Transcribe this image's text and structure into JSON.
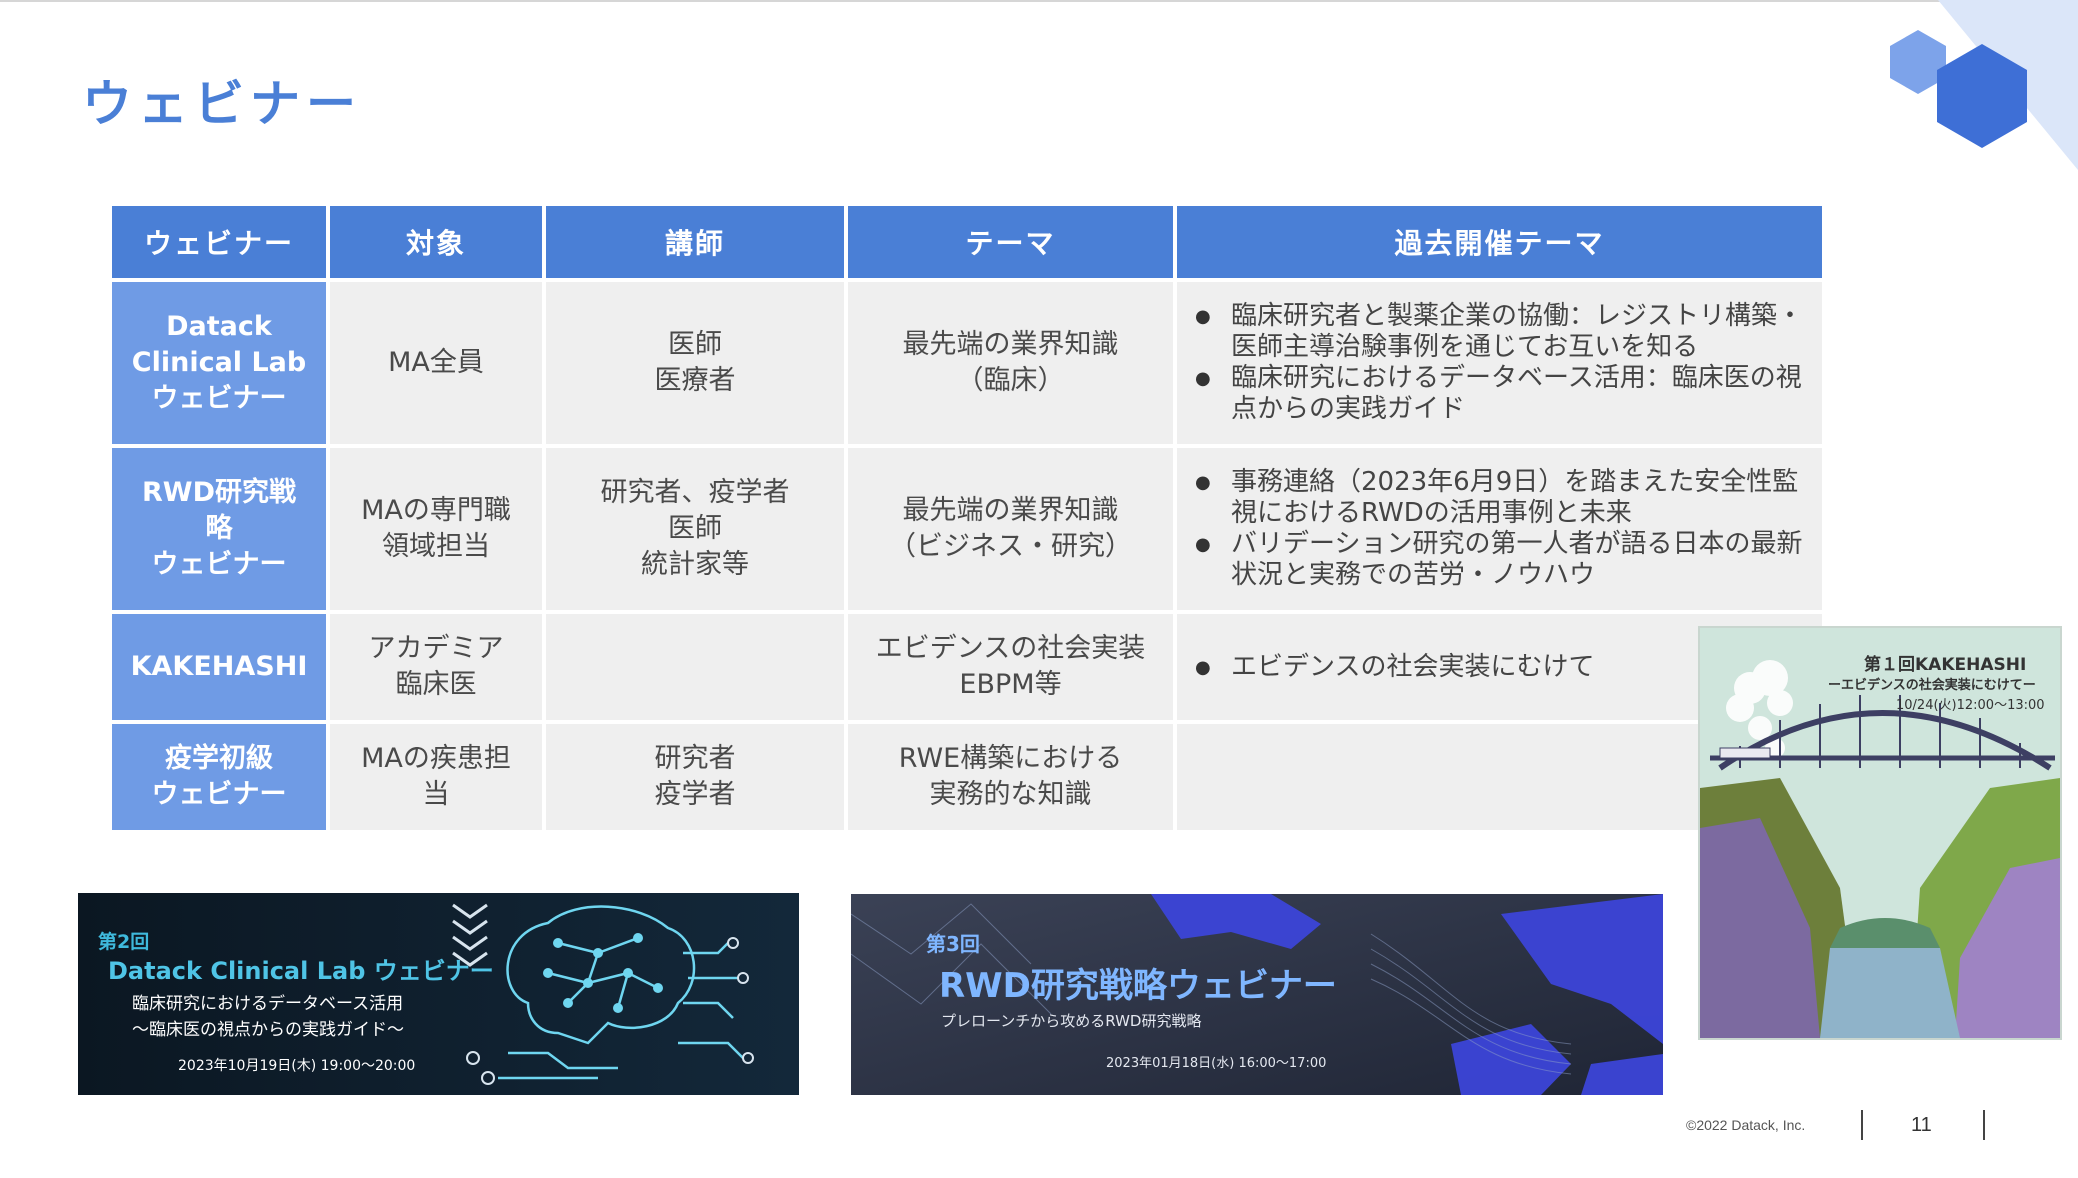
{
  "slide": {
    "title": "ウェビナー",
    "brand_color": "#4a7fd6",
    "header_color": "#4a7fd6",
    "rowhead_color": "#6f9be5"
  },
  "table": {
    "headers": [
      "ウェビナー",
      "対象",
      "講師",
      "テーマ",
      "過去開催テーマ"
    ],
    "rows": [
      {
        "name": "Datack\nClinical Lab\nウェビナー",
        "audience": "MA全員",
        "speakers": "医師\n医療者",
        "theme": "最先端の業界知識\n（臨床）",
        "past_topics": [
          "臨床研究者と製薬企業の協働：レジストリ構築・医師主導治験事例を通じてお互いを知る",
          "臨床研究におけるデータベース活用：臨床医の視点からの実践ガイド"
        ]
      },
      {
        "name": "RWD研究戦\n略\nウェビナー",
        "audience": "MAの専門職\n領域担当",
        "speakers": "研究者、疫学者\n医師\n統計家等",
        "theme": "最先端の業界知識\n（ビジネス・研究）",
        "past_topics": [
          "事務連絡（2023年6月9日）を踏まえた安全性監視におけるRWDの活用事例と未来",
          "バリデーション研究の第一人者が語る日本の最新状況と実務での苦労・ノウハウ"
        ]
      },
      {
        "name": "KAKEHASHI",
        "audience": "アカデミア\n臨床医",
        "speakers": "",
        "theme": "エビデンスの社会実装\nEBPM等",
        "past_topics": [
          "エビデンスの社会実装にむけて"
        ]
      },
      {
        "name": "疫学初級\nウェビナー",
        "audience": "MAの疾患担\n当",
        "speakers": "研究者\n疫学者",
        "theme": "RWE構築における\n実務的な知識",
        "past_topics": []
      }
    ]
  },
  "banners": {
    "clinical_lab": {
      "number": "第2回",
      "title": "Datack Clinical Lab ウェビナー",
      "subtitle1": "臨床研究におけるデータベース活用",
      "subtitle2": "〜臨床医の視点からの実践ガイド〜",
      "datetime": "2023年10月19日(木) 19:00〜20:00"
    },
    "rwd": {
      "number": "第3回",
      "title": "RWD研究戦略ウェビナー",
      "subtitle": "プレローンチから攻めるRWD研究戦略",
      "datetime": "2023年01月18日(水) 16:00〜17:00"
    },
    "kakehashi": {
      "title": "第１回KAKEHASHI",
      "subtitle": "ーエビデンスの社会実装にむけてー",
      "datetime": "10/24(火)12:00〜13:00"
    }
  },
  "footer": {
    "copyright": "©2022 Datack, Inc.",
    "page_number": "11"
  }
}
